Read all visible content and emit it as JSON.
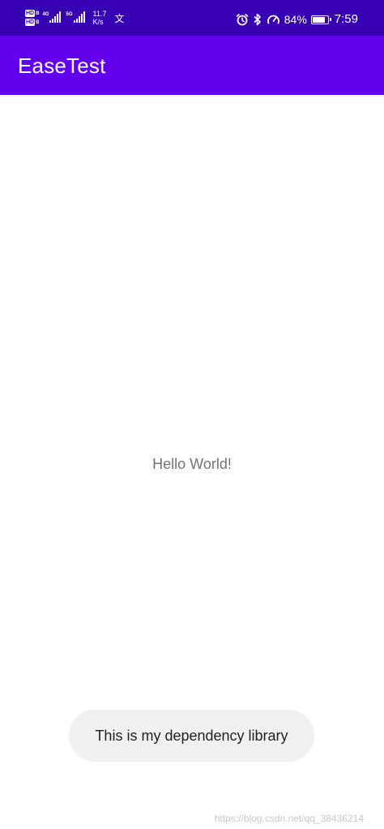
{
  "status_bar": {
    "hd_top": "HD",
    "hd_top_sub": "B",
    "hd_bottom": "HD",
    "hd_bottom_sub": "B",
    "net1_label": "4G",
    "net2_label": "5G",
    "speed_value": "11.7",
    "speed_unit": "K/s",
    "lang_icon_glyph": "文",
    "icons": [
      "hd-icon",
      "signal-icon",
      "alarm-icon",
      "bluetooth-icon",
      "speedometer-icon",
      "battery-icon"
    ],
    "battery_percent": "84%",
    "battery_level": 0.84,
    "time": "7:59"
  },
  "app_bar": {
    "title": "EaseTest"
  },
  "main": {
    "text": "Hello World!"
  },
  "toast": {
    "message": "This is my dependency library"
  },
  "watermark": {
    "text": "https://blog.csdn.net/qq_38436214"
  },
  "colors": {
    "status_bar": "#3700b3",
    "app_bar": "#6200ee",
    "background": "#ffffff",
    "hello_text": "#737373",
    "toast_bg": "#f0f0f0",
    "toast_text": "#1f1f1f"
  }
}
